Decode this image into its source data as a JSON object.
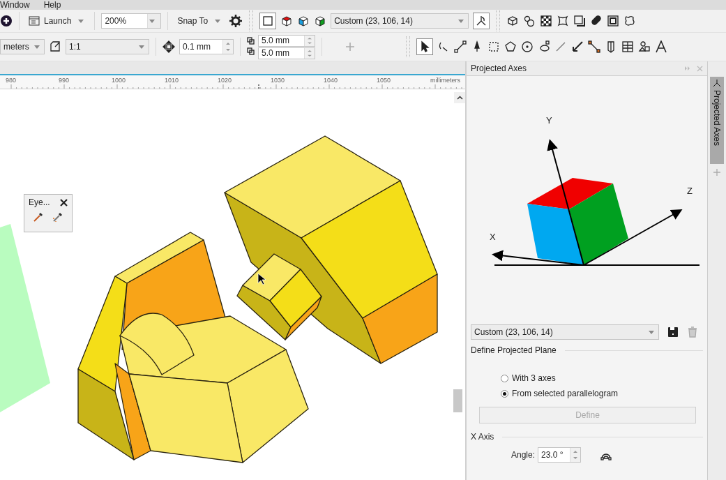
{
  "menu": [
    {
      "label": "Window"
    },
    {
      "label": "Help"
    }
  ],
  "toolbar": {
    "launch": "Launch",
    "zoom": "200%",
    "snap": "Snap To",
    "preset": "Custom (23, 106, 14)"
  },
  "property_bar": {
    "units": "meters",
    "scale": "1:1",
    "nudge": "0.1 mm",
    "dup_x": "5.0 mm",
    "dup_y": "5.0 mm"
  },
  "ruler": {
    "ticks": [
      "980",
      "990",
      "1000",
      "1010",
      "1020",
      "1030",
      "1040",
      "1050"
    ],
    "unit": "millimeters"
  },
  "eyedropper": {
    "title": "Eye..."
  },
  "docker": {
    "title": "Projected Axes",
    "tab": "Projected Axes",
    "axes": [
      {
        "label": "Y"
      },
      {
        "label": "Z"
      },
      {
        "label": "X"
      }
    ],
    "preset": "Custom (23, 106, 14)",
    "plane_section": "Define Projected Plane",
    "options": [
      {
        "label": "With 3 axes",
        "selected": false
      },
      {
        "label": "From selected parallelogram",
        "selected": true
      }
    ],
    "define_button": {
      "label": "Define",
      "disabled": true
    },
    "x_axis_section": "X Axis",
    "angle": {
      "label": "Angle:",
      "value": "23.0 °"
    }
  }
}
